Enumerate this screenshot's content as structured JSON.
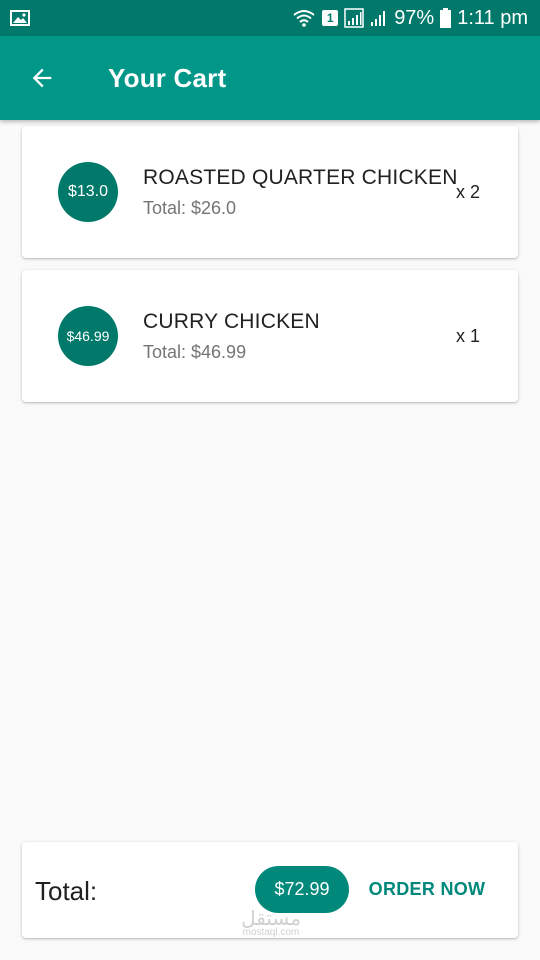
{
  "status_bar": {
    "sim": "1",
    "battery": "97%",
    "time": "1:11 pm"
  },
  "app_bar": {
    "title": "Your Cart"
  },
  "cart": {
    "items": [
      {
        "price": "$13.0",
        "name": "ROASTED QUARTER CHICKEN",
        "total": "Total: $26.0",
        "qty": "x 2"
      },
      {
        "price": "$46.99",
        "name": "CURRY CHICKEN",
        "total": "Total: $46.99",
        "qty": "x 1"
      }
    ]
  },
  "footer": {
    "label": "Total:",
    "total": "$72.99",
    "order_label": "ORDER NOW"
  },
  "watermark": {
    "text": "مستقل",
    "sub": "mostaql.com"
  },
  "colors": {
    "status_bar": "#00796b",
    "app_bar": "#009688",
    "accent": "#00897b"
  }
}
